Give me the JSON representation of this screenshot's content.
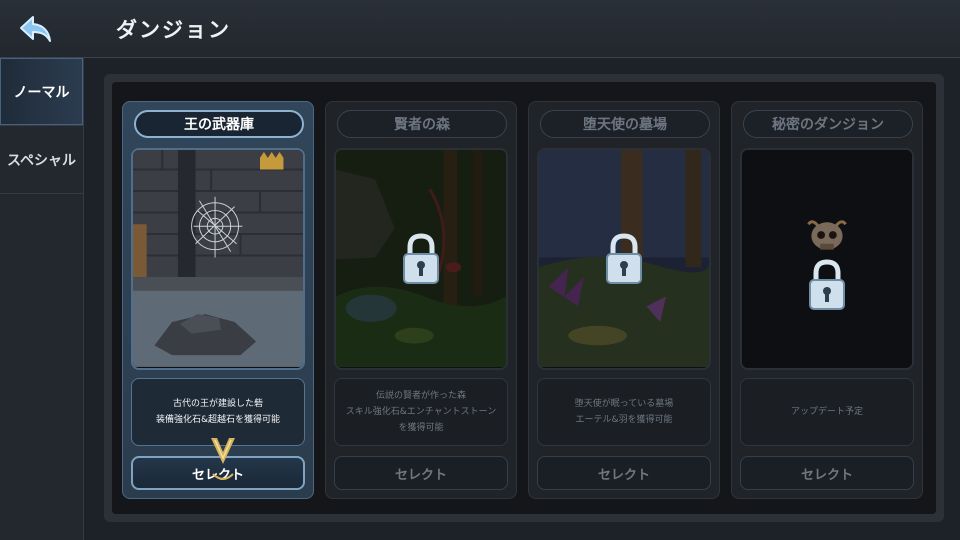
{
  "header": {
    "title": "ダンジョン",
    "back_icon": "back-arrow-icon"
  },
  "sidebar": {
    "items": [
      {
        "label": "ノーマル",
        "active": true
      },
      {
        "label": "スペシャル",
        "active": false
      }
    ]
  },
  "dungeons": [
    {
      "title": "王の武器庫",
      "desc_line1": "古代の王が建設した砦",
      "desc_line2": "装備強化石&超越石を獲得可能",
      "desc_line3": "",
      "button": "セレクト",
      "locked": false,
      "selected": true
    },
    {
      "title": "賢者の森",
      "desc_line1": "伝説の賢者が作った森",
      "desc_line2": "スキル強化石&エンチャントストーン",
      "desc_line3": "を獲得可能",
      "button": "セレクト",
      "locked": true,
      "selected": false
    },
    {
      "title": "堕天使の墓場",
      "desc_line1": "堕天使が眠っている墓場",
      "desc_line2": "エーテル&羽を獲得可能",
      "desc_line3": "",
      "button": "セレクト",
      "locked": true,
      "selected": false
    },
    {
      "title": "秘密のダンジョン",
      "desc_line1": "アップデート予定",
      "desc_line2": "",
      "desc_line3": "",
      "button": "セレクト",
      "locked": true,
      "selected": false
    }
  ],
  "colors": {
    "accent": "#7fa4c3",
    "selected_card": "#31465a",
    "locked_card": "#202429"
  }
}
